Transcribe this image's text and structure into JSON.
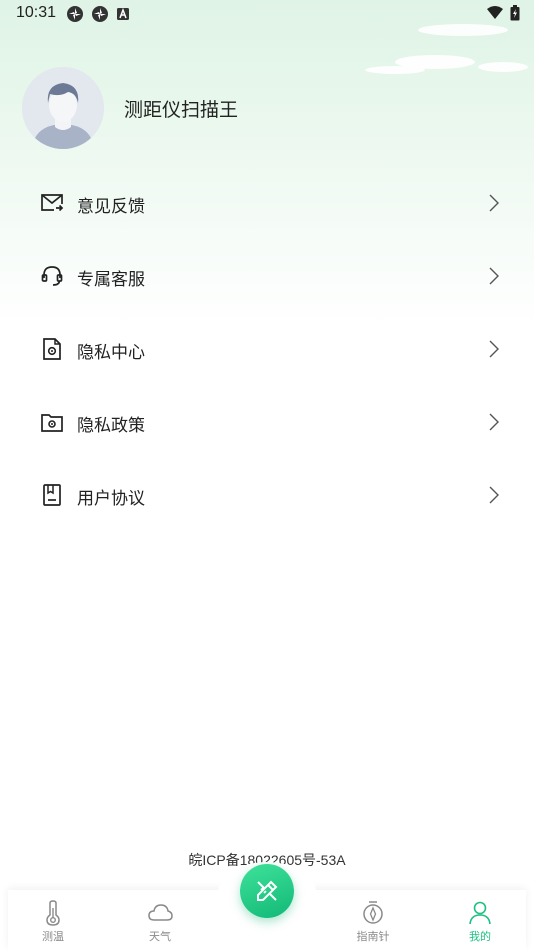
{
  "status_bar": {
    "time": "10:31"
  },
  "profile": {
    "username": "测距仪扫描王"
  },
  "menu": {
    "items": [
      {
        "label": "意见反馈",
        "icon": "feedback-mail-icon"
      },
      {
        "label": "专属客服",
        "icon": "headset-icon"
      },
      {
        "label": "隐私中心",
        "icon": "privacy-doc-icon"
      },
      {
        "label": "隐私政策",
        "icon": "privacy-folder-icon"
      },
      {
        "label": "用户协议",
        "icon": "agreement-book-icon"
      }
    ]
  },
  "footer": {
    "icp": "皖ICP备18022605号-53A"
  },
  "tabbar": {
    "tabs": [
      {
        "label": "测温",
        "icon": "thermometer-icon"
      },
      {
        "label": "天气",
        "icon": "cloud-icon"
      },
      {
        "label": "指南针",
        "icon": "compass-icon"
      },
      {
        "label": "我的",
        "icon": "user-icon"
      }
    ],
    "active": "我的",
    "accent": "#1fbf83"
  }
}
